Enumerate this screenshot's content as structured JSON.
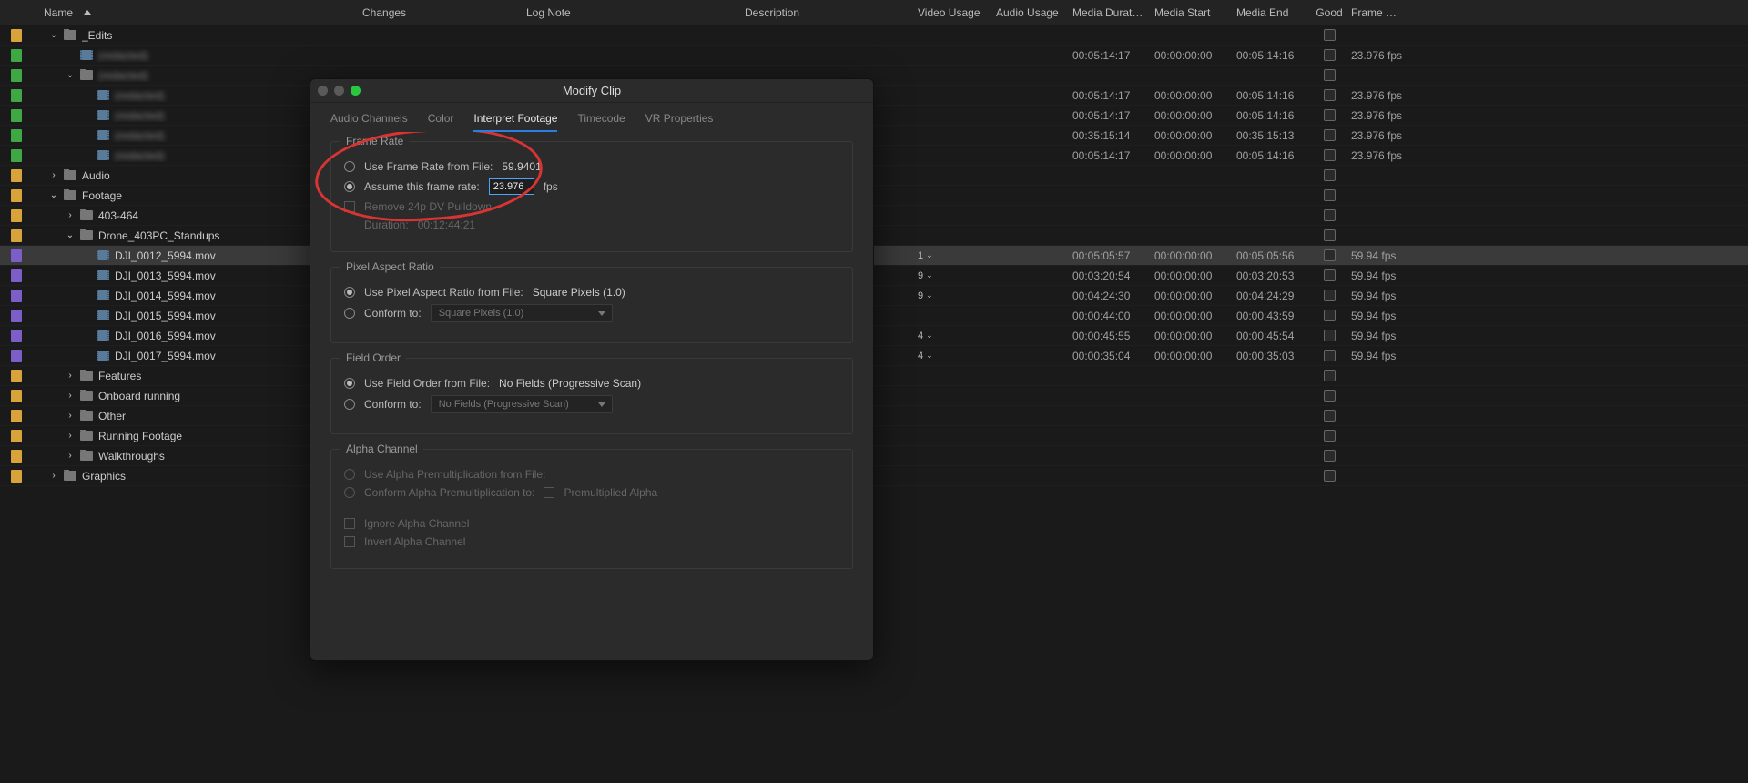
{
  "columns": {
    "name": "Name",
    "changes": "Changes",
    "lognote": "Log Note",
    "description": "Description",
    "video_usage": "Video Usage",
    "audio_usage": "Audio Usage",
    "media_duration": "Media Duration",
    "media_start": "Media Start",
    "media_end": "Media End",
    "good": "Good",
    "frame_rate": "Frame Rate"
  },
  "rows": [
    {
      "type": "bin",
      "label": "_Edits",
      "swatch": "orange",
      "indent": 0,
      "open": true
    },
    {
      "type": "clip",
      "label": "(redacted)",
      "swatch": "green",
      "indent": 1,
      "blur": true,
      "media_duration": "00:05:14:17",
      "media_start": "00:00:00:00",
      "media_end": "00:05:14:16",
      "frame_rate": "23.976 fps"
    },
    {
      "type": "bin",
      "label": "(redacted)",
      "swatch": "green",
      "indent": 1,
      "open": true,
      "blur": true
    },
    {
      "type": "clip",
      "label": "(redacted)",
      "swatch": "green",
      "indent": 2,
      "blur": true,
      "media_duration": "00:05:14:17",
      "media_start": "00:00:00:00",
      "media_end": "00:05:14:16",
      "frame_rate": "23.976 fps"
    },
    {
      "type": "clip",
      "label": "(redacted)",
      "swatch": "green",
      "indent": 2,
      "blur": true,
      "media_duration": "00:05:14:17",
      "media_start": "00:00:00:00",
      "media_end": "00:05:14:16",
      "frame_rate": "23.976 fps"
    },
    {
      "type": "clip",
      "label": "(redacted)",
      "swatch": "green",
      "indent": 2,
      "blur": true,
      "media_duration": "00:35:15:14",
      "media_start": "00:00:00:00",
      "media_end": "00:35:15:13",
      "frame_rate": "23.976 fps"
    },
    {
      "type": "clip",
      "label": "(redacted)",
      "swatch": "green",
      "indent": 2,
      "blur": true,
      "media_duration": "00:05:14:17",
      "media_start": "00:00:00:00",
      "media_end": "00:05:14:16",
      "frame_rate": "23.976 fps"
    },
    {
      "type": "bin",
      "label": "Audio",
      "swatch": "orange",
      "indent": 0,
      "open": false
    },
    {
      "type": "bin",
      "label": "Footage",
      "swatch": "orange",
      "indent": 0,
      "open": true
    },
    {
      "type": "bin",
      "label": "403-464",
      "swatch": "orange",
      "indent": 1,
      "open": false
    },
    {
      "type": "bin",
      "label": "Drone_403PC_Standups",
      "swatch": "orange",
      "indent": 1,
      "open": true
    },
    {
      "type": "clip",
      "label": "DJI_0012_5994.mov",
      "swatch": "purple",
      "indent": 2,
      "selected": true,
      "video_usage": "1",
      "media_duration": "00:05:05:57",
      "media_start": "00:00:00:00",
      "media_end": "00:05:05:56",
      "frame_rate": "59.94 fps"
    },
    {
      "type": "clip",
      "label": "DJI_0013_5994.mov",
      "swatch": "purple",
      "indent": 2,
      "video_usage": "9",
      "media_duration": "00:03:20:54",
      "media_start": "00:00:00:00",
      "media_end": "00:03:20:53",
      "frame_rate": "59.94 fps"
    },
    {
      "type": "clip",
      "label": "DJI_0014_5994.mov",
      "swatch": "purple",
      "indent": 2,
      "video_usage": "9",
      "media_duration": "00:04:24:30",
      "media_start": "00:00:00:00",
      "media_end": "00:04:24:29",
      "frame_rate": "59.94 fps"
    },
    {
      "type": "clip",
      "label": "DJI_0015_5994.mov",
      "swatch": "purple",
      "indent": 2,
      "media_duration": "00:00:44:00",
      "media_start": "00:00:00:00",
      "media_end": "00:00:43:59",
      "frame_rate": "59.94 fps"
    },
    {
      "type": "clip",
      "label": "DJI_0016_5994.mov",
      "swatch": "purple",
      "indent": 2,
      "video_usage": "4",
      "media_duration": "00:00:45:55",
      "media_start": "00:00:00:00",
      "media_end": "00:00:45:54",
      "frame_rate": "59.94 fps"
    },
    {
      "type": "clip",
      "label": "DJI_0017_5994.mov",
      "swatch": "purple",
      "indent": 2,
      "video_usage": "4",
      "media_duration": "00:00:35:04",
      "media_start": "00:00:00:00",
      "media_end": "00:00:35:03",
      "frame_rate": "59.94 fps"
    },
    {
      "type": "bin",
      "label": "Features",
      "swatch": "orange",
      "indent": 1,
      "open": false
    },
    {
      "type": "bin",
      "label": "Onboard running",
      "swatch": "orange",
      "indent": 1,
      "open": false
    },
    {
      "type": "bin",
      "label": "Other",
      "swatch": "orange",
      "indent": 1,
      "open": false
    },
    {
      "type": "bin",
      "label": "Running Footage",
      "swatch": "orange",
      "indent": 1,
      "open": false
    },
    {
      "type": "bin",
      "label": "Walkthroughs",
      "swatch": "orange",
      "indent": 1,
      "open": false
    },
    {
      "type": "bin",
      "label": "Graphics",
      "swatch": "orange",
      "indent": 0,
      "open": false
    }
  ],
  "modal": {
    "title": "Modify Clip",
    "tabs": {
      "audio_channels": "Audio Channels",
      "color": "Color",
      "interpret_footage": "Interpret Footage",
      "timecode": "Timecode",
      "vr_properties": "VR Properties"
    },
    "frame_rate": {
      "group_title": "Frame Rate",
      "use_from_file_label": "Use Frame Rate from File:",
      "use_from_file_value": "59.9401",
      "assume_label": "Assume this frame rate:",
      "assume_value": "23.976",
      "fps_suffix": "fps",
      "remove_pulldown": "Remove 24p DV Pulldown",
      "duration_label": "Duration:",
      "duration_value": "00:12:44:21"
    },
    "pixel_aspect": {
      "group_title": "Pixel Aspect Ratio",
      "use_from_file_label": "Use Pixel Aspect Ratio from File:",
      "use_from_file_value": "Square Pixels (1.0)",
      "conform_label": "Conform to:",
      "conform_value": "Square Pixels (1.0)"
    },
    "field_order": {
      "group_title": "Field Order",
      "use_from_file_label": "Use Field Order from File:",
      "use_from_file_value": "No Fields (Progressive Scan)",
      "conform_label": "Conform to:",
      "conform_value": "No Fields (Progressive Scan)"
    },
    "alpha": {
      "group_title": "Alpha Channel",
      "use_from_file_label": "Use Alpha Premultiplication from File:",
      "conform_label": "Conform Alpha Premultiplication to:",
      "premultiplied_label": "Premultiplied Alpha",
      "ignore_label": "Ignore Alpha Channel",
      "invert_label": "Invert Alpha Channel"
    }
  }
}
